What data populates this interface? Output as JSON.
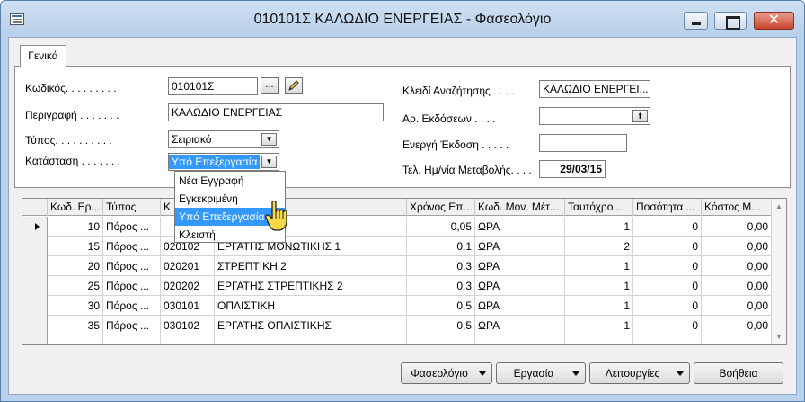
{
  "window": {
    "title": "010101Σ ΚΑΛΩΔΙΟ ΕΝΕΡΓΕΙΑΣ - Φασεολόγιο",
    "close_glyph": "✕"
  },
  "tabs": [
    {
      "label": "Γενικά"
    }
  ],
  "form": {
    "code_label": "Κωδικός. . . . . . . . .",
    "code_value": "010101Σ",
    "code_browse": "...",
    "description_label": "Περιγραφή . . . . . . .",
    "description_value": "ΚΑΛΩΔΙΟ ΕΝΕΡΓΕΙΑΣ",
    "type_label": "Τύπος. . . . . . . . . .",
    "type_value": "Σειριακό",
    "status_label": "Κατάσταση . . . . . . .",
    "status_value": "Υπό Επεξεργασία",
    "search_key_label": "Κλειδί Αναζήτησης . . . .",
    "search_key_value": "ΚΑΛΩΔΙΟ ΕΝΕΡΓΕΙ...",
    "versions_label": "Αρ. Εκδόσεων . . . .",
    "versions_value": "",
    "active_version_label": "Ενεργή Έκδοση . . . . .",
    "active_version_value": "",
    "last_change_label": "Τελ. Ημ/νία Μεταβολής. . . .",
    "last_change_value": "29/03/15"
  },
  "status_dropdown": {
    "options": [
      "Νέα Εγγραφή",
      "Εγκεκριμένη",
      "Υπό Επεξεργασία",
      "Κλειστή"
    ],
    "highlighted": "Υπό Επεξεργασία"
  },
  "grid": {
    "columns": [
      "Κωδ. Ερ...",
      "Τύπος",
      "Κ",
      "",
      "Χρόνος Επ...",
      "Κωδ. Μον. Μέτ...",
      "Ταυτόχρο...",
      "Ποσότητα ...",
      "Κόστος Μ..."
    ],
    "rows": [
      {
        "code": "10",
        "type": "Πόρος ...",
        "k": "",
        "work": "",
        "time": "0,05",
        "unit": "ΩΡΑ",
        "simult": "1",
        "qty": "0",
        "cost": "0,00"
      },
      {
        "code": "15",
        "type": "Πόρος ...",
        "k": "020102",
        "work": "ΕΡΓΑΤΗΣ ΜΟΝΩΤΙΚΗΣ 1",
        "time": "0,1",
        "unit": "ΩΡΑ",
        "simult": "2",
        "qty": "0",
        "cost": "0,00"
      },
      {
        "code": "20",
        "type": "Πόρος ...",
        "k": "020201",
        "work": "ΣΤΡΕΠΤΙΚΗ 2",
        "time": "0,3",
        "unit": "ΩΡΑ",
        "simult": "1",
        "qty": "0",
        "cost": "0,00"
      },
      {
        "code": "25",
        "type": "Πόρος ...",
        "k": "020202",
        "work": "ΕΡΓΑΤΗΣ ΣΤΡΕΠΤΙΚΗΣ 2",
        "time": "0,3",
        "unit": "ΩΡΑ",
        "simult": "1",
        "qty": "0",
        "cost": "0,00"
      },
      {
        "code": "30",
        "type": "Πόρος ...",
        "k": "030101",
        "work": "ΟΠΛΙΣΤΙΚΗ",
        "time": "0,5",
        "unit": "ΩΡΑ",
        "simult": "1",
        "qty": "0",
        "cost": "0,00"
      },
      {
        "code": "35",
        "type": "Πόρος ...",
        "k": "030102",
        "work": "ΕΡΓΑΤΗΣ ΟΠΛΙΣΤΙΚΗΣ",
        "time": "0,5",
        "unit": "ΩΡΑ",
        "simult": "1",
        "qty": "0",
        "cost": "0,00"
      }
    ]
  },
  "buttons": {
    "phaseology": "Φασεολόγιο",
    "work": "Εργασία",
    "functions": "Λειτουργίες",
    "help": "Βοήθεια"
  },
  "icons": [
    "app-icon",
    "pencil-icon",
    "dropdown-arrow-icon",
    "hand-cursor-icon",
    "up-arrow-icon"
  ],
  "colors": {
    "selection": "#3399ff",
    "titlebar": "#b9d1ea",
    "close_button": "#c8462f"
  }
}
